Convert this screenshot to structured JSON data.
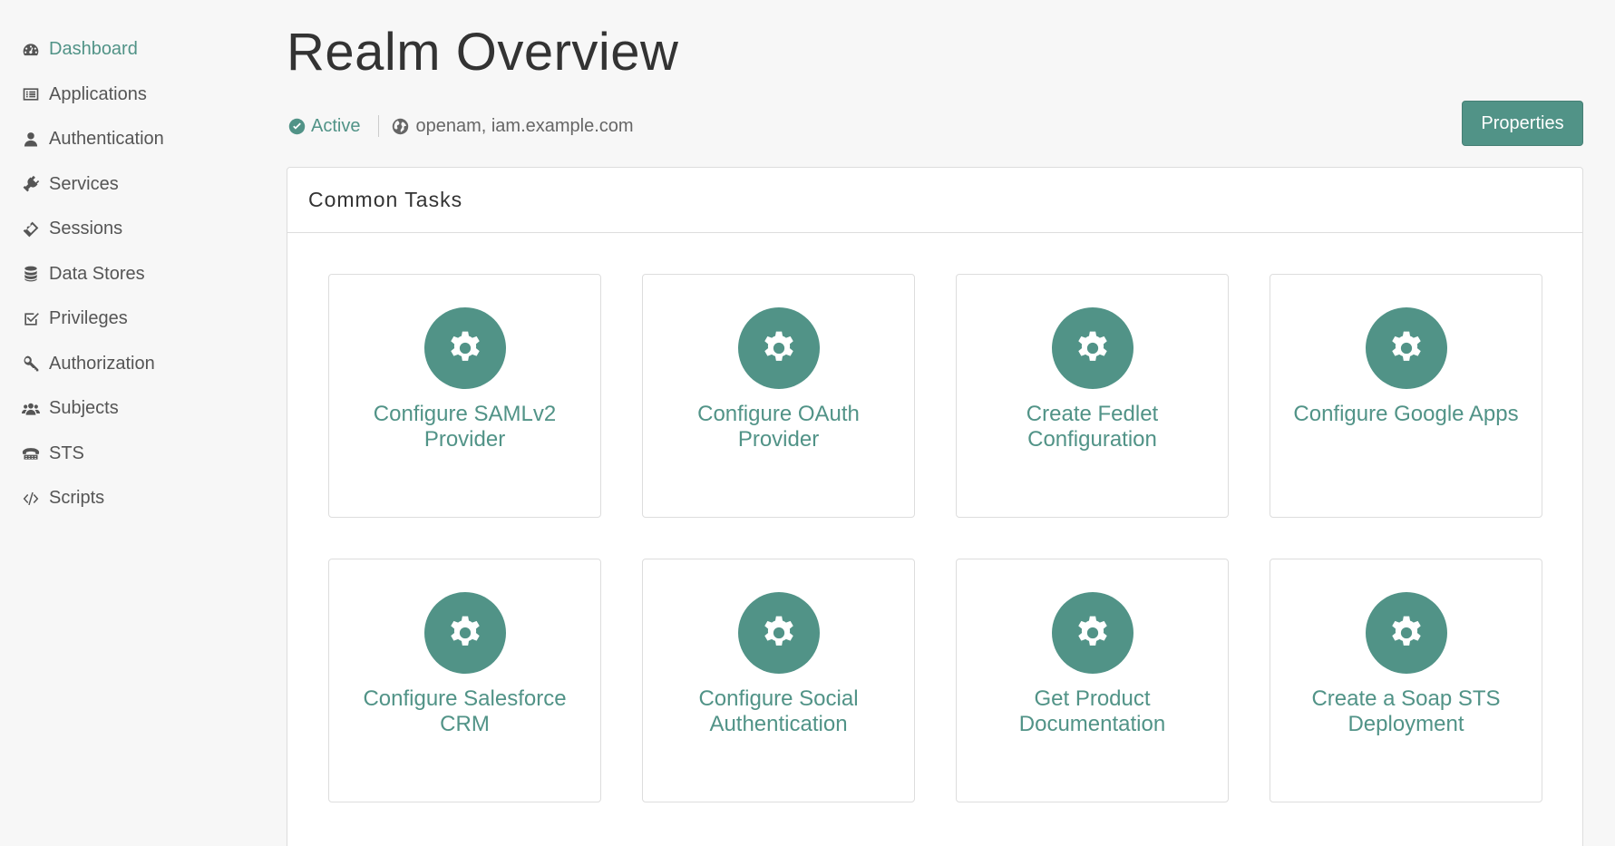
{
  "sidebar": {
    "items": [
      {
        "label": "Dashboard",
        "icon": "dashboard-icon",
        "active": true
      },
      {
        "label": "Applications",
        "icon": "list-icon"
      },
      {
        "label": "Authentication",
        "icon": "user-icon"
      },
      {
        "label": "Services",
        "icon": "plug-icon"
      },
      {
        "label": "Sessions",
        "icon": "ticket-icon"
      },
      {
        "label": "Data Stores",
        "icon": "database-icon"
      },
      {
        "label": "Privileges",
        "icon": "check-square-icon"
      },
      {
        "label": "Authorization",
        "icon": "key-icon"
      },
      {
        "label": "Subjects",
        "icon": "users-icon"
      },
      {
        "label": "STS",
        "icon": "fax-icon"
      },
      {
        "label": "Scripts",
        "icon": "code-icon"
      }
    ]
  },
  "header": {
    "title": "Realm Overview",
    "status": "Active",
    "host": "openam, iam.example.com",
    "properties_label": "Properties"
  },
  "panel": {
    "title": "Common Tasks",
    "tasks": [
      {
        "label": "Configure SAMLv2 Provider",
        "icon": "gear-icon"
      },
      {
        "label": "Configure OAuth Provider",
        "icon": "gear-icon"
      },
      {
        "label": "Create Fedlet Configuration",
        "icon": "gear-icon"
      },
      {
        "label": "Configure Google Apps",
        "icon": "gear-icon"
      },
      {
        "label": "Configure Salesforce CRM",
        "icon": "gear-icon"
      },
      {
        "label": "Configure Social Authentication",
        "icon": "gear-icon"
      },
      {
        "label": "Get Product Documentation",
        "icon": "gear-icon"
      },
      {
        "label": "Create a Soap STS Deployment",
        "icon": "gear-icon"
      }
    ]
  },
  "colors": {
    "accent": "#519387",
    "background": "#f7f7f7",
    "text": "#333333"
  }
}
